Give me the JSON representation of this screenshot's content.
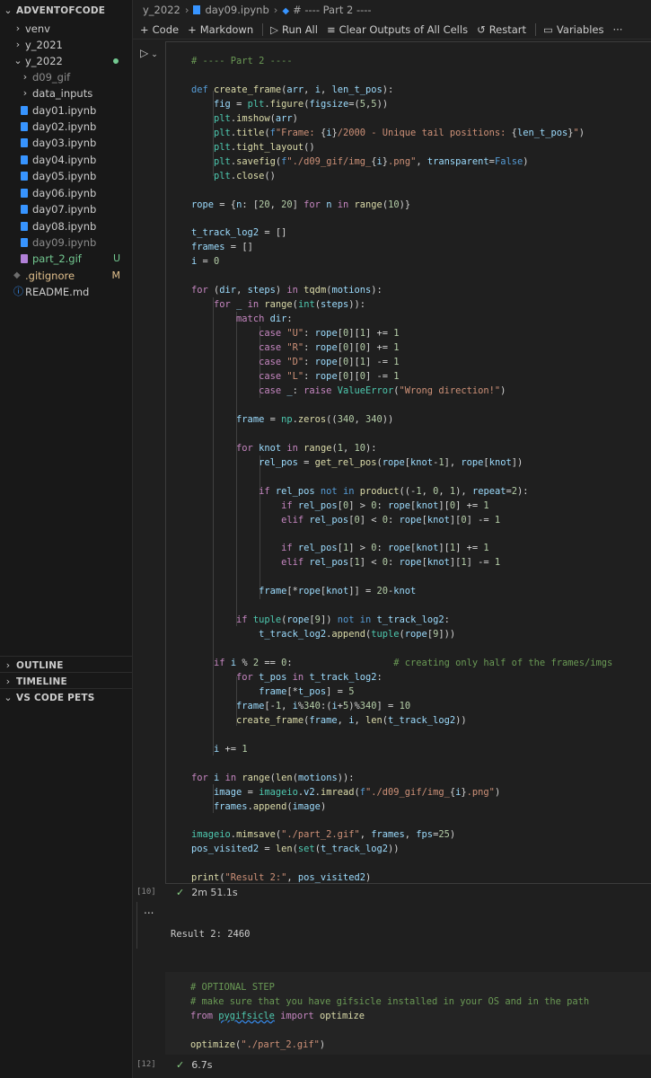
{
  "sidebar": {
    "root": "ADVENTOFCODE",
    "items": [
      {
        "label": "venv",
        "kind": "folder",
        "open": false,
        "depth": 1
      },
      {
        "label": "y_2021",
        "kind": "folder",
        "open": false,
        "depth": 1
      },
      {
        "label": "y_2022",
        "kind": "folder",
        "open": true,
        "depth": 1,
        "modified_dot": true
      },
      {
        "label": "d09_gif",
        "kind": "folder",
        "open": false,
        "depth": 2,
        "dim": true
      },
      {
        "label": "data_inputs",
        "kind": "folder",
        "open": false,
        "depth": 2
      },
      {
        "label": "day01.ipynb",
        "kind": "notebook",
        "depth": 2
      },
      {
        "label": "day02.ipynb",
        "kind": "notebook",
        "depth": 2
      },
      {
        "label": "day03.ipynb",
        "kind": "notebook",
        "depth": 2
      },
      {
        "label": "day04.ipynb",
        "kind": "notebook",
        "depth": 2
      },
      {
        "label": "day05.ipynb",
        "kind": "notebook",
        "depth": 2
      },
      {
        "label": "day06.ipynb",
        "kind": "notebook",
        "depth": 2
      },
      {
        "label": "day07.ipynb",
        "kind": "notebook",
        "depth": 2
      },
      {
        "label": "day08.ipynb",
        "kind": "notebook",
        "depth": 2
      },
      {
        "label": "day09.ipynb",
        "kind": "notebook",
        "depth": 2,
        "dim": true
      },
      {
        "label": "part_2.gif",
        "kind": "gif",
        "depth": 2,
        "badge": "U"
      },
      {
        "label": ".gitignore",
        "kind": "ignore",
        "depth": 1,
        "badge": "M"
      },
      {
        "label": "README.md",
        "kind": "info",
        "depth": 1
      }
    ],
    "sections": [
      "OUTLINE",
      "TIMELINE",
      "VS CODE PETS"
    ]
  },
  "colors": {
    "untracked": "#73c991",
    "modified": "#e2c08d",
    "gif_label": "#73c991",
    "ignore_label": "#e2c08d"
  },
  "breadcrumb": {
    "folder": "y_2022",
    "file": "day09.ipynb",
    "cell": "# ---- Part 2 ----"
  },
  "toolbar": {
    "code": "Code",
    "markdown": "Markdown",
    "run_all": "Run All",
    "clear_outputs": "Clear Outputs of All Cells",
    "restart": "Restart",
    "variables": "Variables",
    "more": "···"
  },
  "cell1": {
    "exec_count": "[10]",
    "status": "2m 51.1s"
  },
  "output1": {
    "ellipsis": "...",
    "text": "Result 2: 2460"
  },
  "cell2": {
    "exec_count": "[12]",
    "status": "6.7s"
  }
}
